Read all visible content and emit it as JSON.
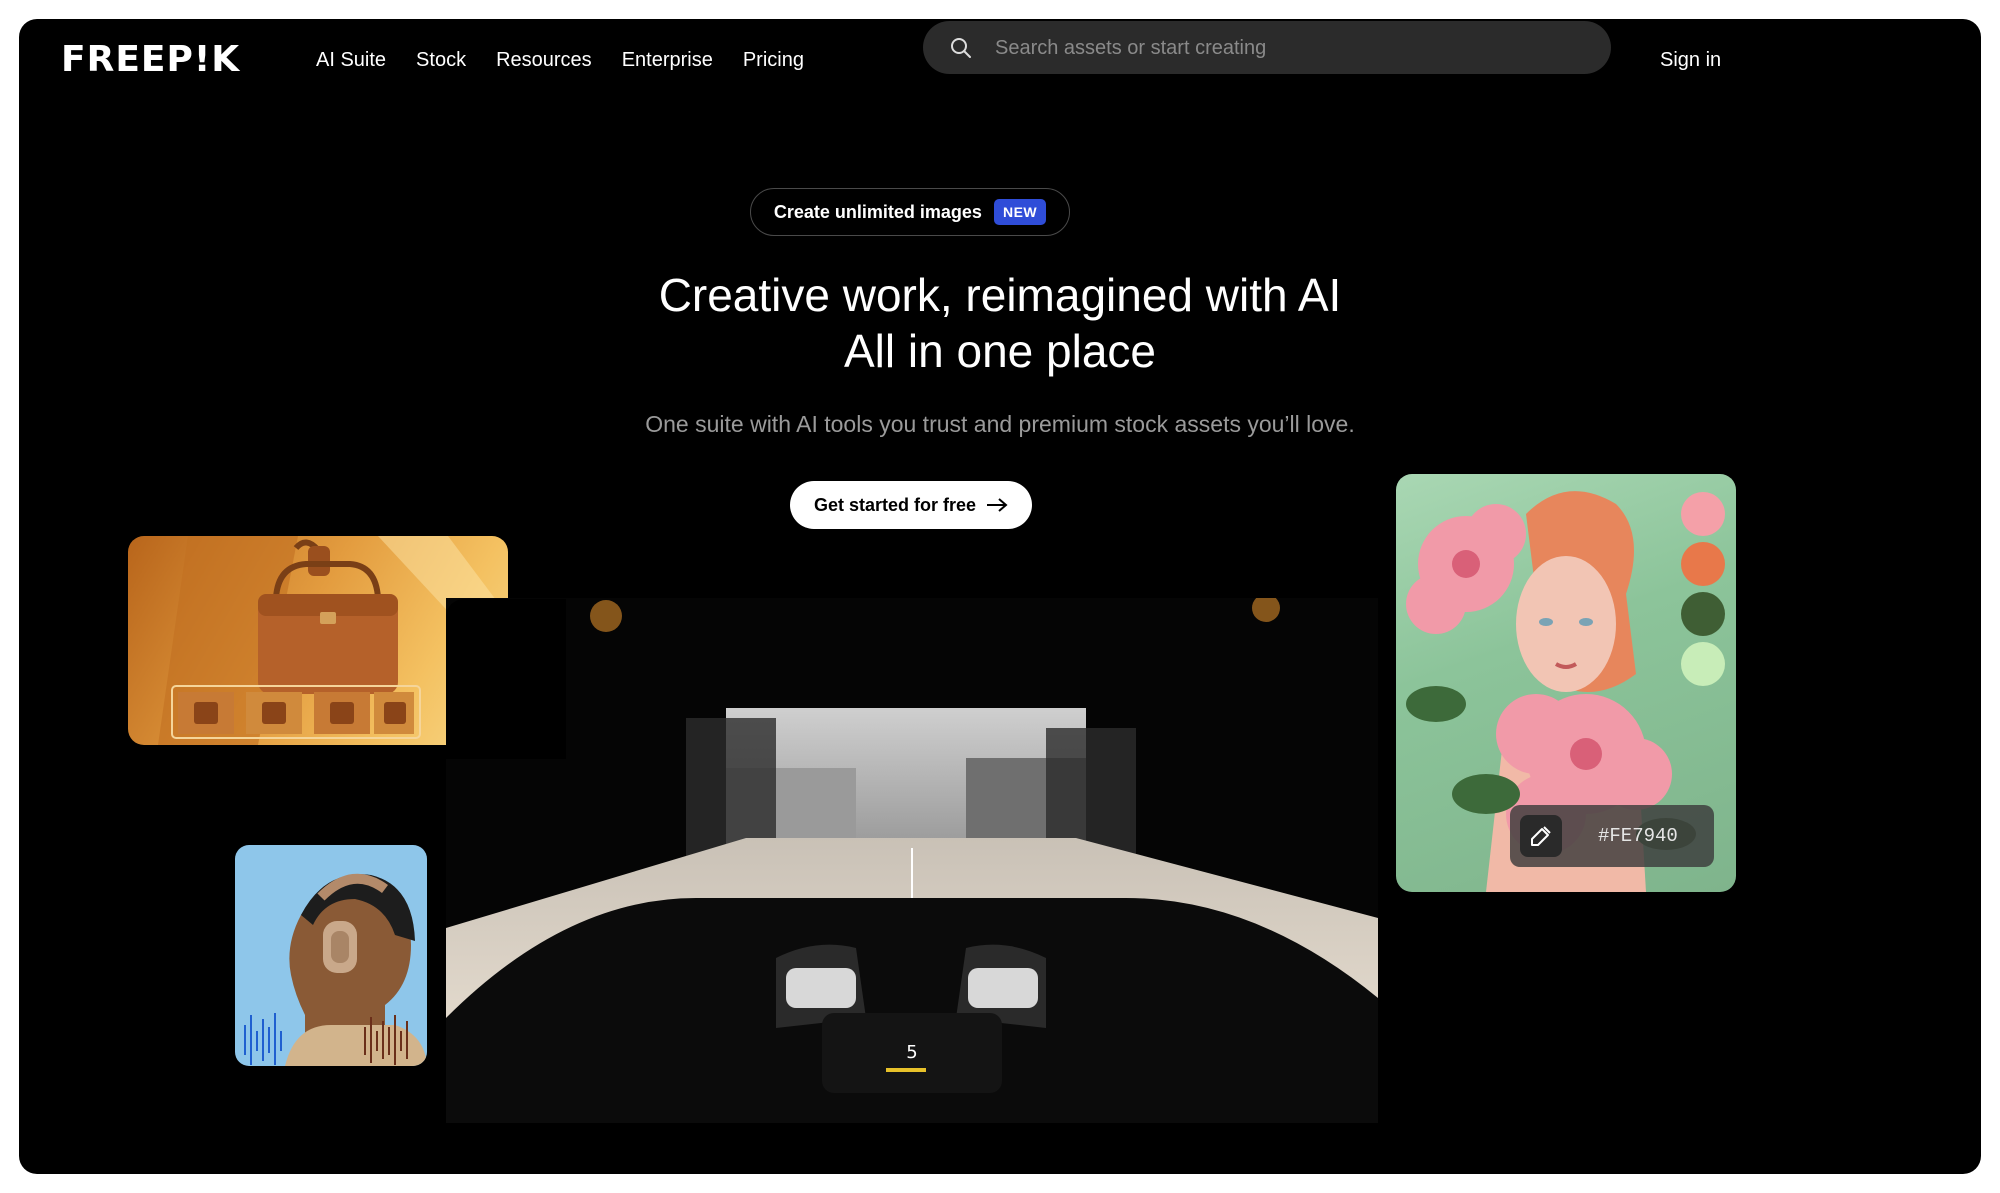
{
  "header": {
    "logo_text": "FREEP!K",
    "nav": [
      "AI Suite",
      "Stock",
      "Resources",
      "Enterprise",
      "Pricing"
    ],
    "search_placeholder": "Search assets or start creating",
    "sign_in": "Sign in"
  },
  "hero": {
    "promo_text": "Create unlimited images",
    "promo_badge": "NEW",
    "headline_line1": "Creative work, reimagined with AI",
    "headline_line2": "All in one place",
    "subhead": "One suite with AI tools you trust and premium stock assets you’ll love.",
    "cta_label": "Get started for free"
  },
  "color_card": {
    "swatches": [
      "#F4A0A8",
      "#E8784A",
      "#3F5E34",
      "#C8EDB8"
    ],
    "picked_hex": "#FE7940"
  },
  "video_card": {
    "dash_gear": "5"
  },
  "colors": {
    "background": "#000000",
    "badge": "#2F4DD8",
    "accent_orange": "#FE7940"
  }
}
